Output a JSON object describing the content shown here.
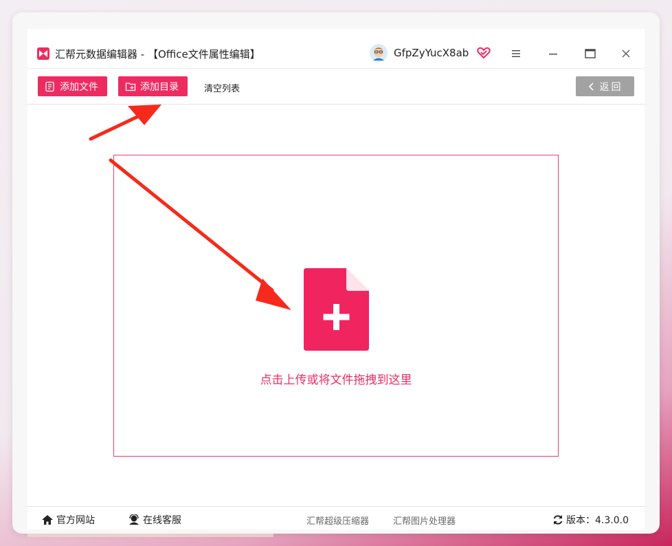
{
  "window": {
    "title": "汇帮元数据编辑器 - 【Office文件属性编辑】",
    "username": "GfpZyYucX8ab"
  },
  "toolbar": {
    "add_file": "添加文件",
    "add_dir": "添加目录",
    "clear_list": "清空列表",
    "back": "返回"
  },
  "dropzone": {
    "hint": "点击上传或将文件拖拽到这里"
  },
  "footer": {
    "official_site": "官方网站",
    "online_support": "在线客服",
    "compressor": "汇帮超级压缩器",
    "image_processor": "汇帮图片处理器",
    "version": "版本：4.3.0.0"
  },
  "colors": {
    "accent": "#ee2b61",
    "annotation_arrow": "#f52a1c",
    "back_button": "#a2a2a2"
  }
}
